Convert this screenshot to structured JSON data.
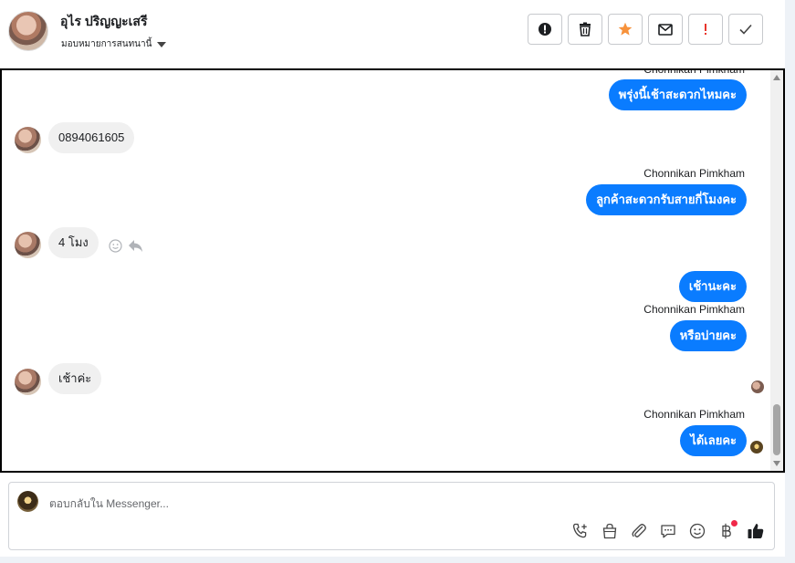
{
  "header": {
    "contact_name": "อุไร ปริญญะเสรี",
    "assign_label": "มอบหมายการสนทนานี้",
    "toolbar": [
      {
        "name": "spam-alert-button",
        "icon": "alert-circle-icon"
      },
      {
        "name": "delete-button",
        "icon": "trash-icon"
      },
      {
        "name": "star-button",
        "icon": "star-icon",
        "color": "#f7923b"
      },
      {
        "name": "mark-unread-button",
        "icon": "envelope-icon"
      },
      {
        "name": "follow-up-button",
        "icon": "exclamation-icon",
        "color": "#e8352c"
      },
      {
        "name": "mark-done-button",
        "icon": "check-icon"
      }
    ]
  },
  "messages": {
    "m1_sender": "Chonnikan Pimkham",
    "m1_text": "พรุ่งนี้เช้าสะดวกไหมคะ",
    "m2_text": "0894061605",
    "m3_sender": "Chonnikan Pimkham",
    "m3_text": "ลูกค้าสะดวกรับสายกี่โมงคะ",
    "m4_text": "4 โมง",
    "m5_text": "เช้านะคะ",
    "m6_sender": "Chonnikan Pimkham",
    "m6_text": "หรือบ่ายคะ",
    "m7_text": "เช้าค่ะ",
    "m8_sender": "Chonnikan Pimkham",
    "m8_text": "ได้เลยคะ"
  },
  "composer": {
    "placeholder": "ตอบกลับใน Messenger...",
    "icons": [
      "phone-plus-icon",
      "shopping-bag-icon",
      "paperclip-icon",
      "chat-bubble-icon",
      "smiley-icon",
      "baht-icon",
      "thumbs-up-icon"
    ]
  },
  "colors": {
    "outgoing_bubble": "#0a7cff",
    "incoming_bubble": "#f0f0f0",
    "notification_dot": "#f02849"
  }
}
